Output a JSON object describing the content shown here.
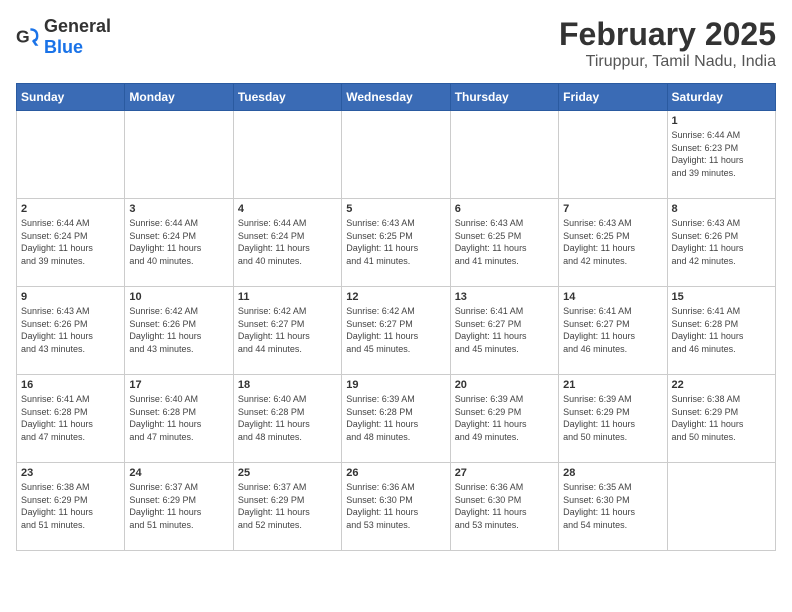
{
  "logo": {
    "general": "General",
    "blue": "Blue"
  },
  "title": "February 2025",
  "subtitle": "Tiruppur, Tamil Nadu, India",
  "days_of_week": [
    "Sunday",
    "Monday",
    "Tuesday",
    "Wednesday",
    "Thursday",
    "Friday",
    "Saturday"
  ],
  "weeks": [
    [
      {
        "day": "",
        "info": ""
      },
      {
        "day": "",
        "info": ""
      },
      {
        "day": "",
        "info": ""
      },
      {
        "day": "",
        "info": ""
      },
      {
        "day": "",
        "info": ""
      },
      {
        "day": "",
        "info": ""
      },
      {
        "day": "1",
        "info": "Sunrise: 6:44 AM\nSunset: 6:23 PM\nDaylight: 11 hours\nand 39 minutes."
      }
    ],
    [
      {
        "day": "2",
        "info": "Sunrise: 6:44 AM\nSunset: 6:24 PM\nDaylight: 11 hours\nand 39 minutes."
      },
      {
        "day": "3",
        "info": "Sunrise: 6:44 AM\nSunset: 6:24 PM\nDaylight: 11 hours\nand 40 minutes."
      },
      {
        "day": "4",
        "info": "Sunrise: 6:44 AM\nSunset: 6:24 PM\nDaylight: 11 hours\nand 40 minutes."
      },
      {
        "day": "5",
        "info": "Sunrise: 6:43 AM\nSunset: 6:25 PM\nDaylight: 11 hours\nand 41 minutes."
      },
      {
        "day": "6",
        "info": "Sunrise: 6:43 AM\nSunset: 6:25 PM\nDaylight: 11 hours\nand 41 minutes."
      },
      {
        "day": "7",
        "info": "Sunrise: 6:43 AM\nSunset: 6:25 PM\nDaylight: 11 hours\nand 42 minutes."
      },
      {
        "day": "8",
        "info": "Sunrise: 6:43 AM\nSunset: 6:26 PM\nDaylight: 11 hours\nand 42 minutes."
      }
    ],
    [
      {
        "day": "9",
        "info": "Sunrise: 6:43 AM\nSunset: 6:26 PM\nDaylight: 11 hours\nand 43 minutes."
      },
      {
        "day": "10",
        "info": "Sunrise: 6:42 AM\nSunset: 6:26 PM\nDaylight: 11 hours\nand 43 minutes."
      },
      {
        "day": "11",
        "info": "Sunrise: 6:42 AM\nSunset: 6:27 PM\nDaylight: 11 hours\nand 44 minutes."
      },
      {
        "day": "12",
        "info": "Sunrise: 6:42 AM\nSunset: 6:27 PM\nDaylight: 11 hours\nand 45 minutes."
      },
      {
        "day": "13",
        "info": "Sunrise: 6:41 AM\nSunset: 6:27 PM\nDaylight: 11 hours\nand 45 minutes."
      },
      {
        "day": "14",
        "info": "Sunrise: 6:41 AM\nSunset: 6:27 PM\nDaylight: 11 hours\nand 46 minutes."
      },
      {
        "day": "15",
        "info": "Sunrise: 6:41 AM\nSunset: 6:28 PM\nDaylight: 11 hours\nand 46 minutes."
      }
    ],
    [
      {
        "day": "16",
        "info": "Sunrise: 6:41 AM\nSunset: 6:28 PM\nDaylight: 11 hours\nand 47 minutes."
      },
      {
        "day": "17",
        "info": "Sunrise: 6:40 AM\nSunset: 6:28 PM\nDaylight: 11 hours\nand 47 minutes."
      },
      {
        "day": "18",
        "info": "Sunrise: 6:40 AM\nSunset: 6:28 PM\nDaylight: 11 hours\nand 48 minutes."
      },
      {
        "day": "19",
        "info": "Sunrise: 6:39 AM\nSunset: 6:28 PM\nDaylight: 11 hours\nand 48 minutes."
      },
      {
        "day": "20",
        "info": "Sunrise: 6:39 AM\nSunset: 6:29 PM\nDaylight: 11 hours\nand 49 minutes."
      },
      {
        "day": "21",
        "info": "Sunrise: 6:39 AM\nSunset: 6:29 PM\nDaylight: 11 hours\nand 50 minutes."
      },
      {
        "day": "22",
        "info": "Sunrise: 6:38 AM\nSunset: 6:29 PM\nDaylight: 11 hours\nand 50 minutes."
      }
    ],
    [
      {
        "day": "23",
        "info": "Sunrise: 6:38 AM\nSunset: 6:29 PM\nDaylight: 11 hours\nand 51 minutes."
      },
      {
        "day": "24",
        "info": "Sunrise: 6:37 AM\nSunset: 6:29 PM\nDaylight: 11 hours\nand 51 minutes."
      },
      {
        "day": "25",
        "info": "Sunrise: 6:37 AM\nSunset: 6:29 PM\nDaylight: 11 hours\nand 52 minutes."
      },
      {
        "day": "26",
        "info": "Sunrise: 6:36 AM\nSunset: 6:30 PM\nDaylight: 11 hours\nand 53 minutes."
      },
      {
        "day": "27",
        "info": "Sunrise: 6:36 AM\nSunset: 6:30 PM\nDaylight: 11 hours\nand 53 minutes."
      },
      {
        "day": "28",
        "info": "Sunrise: 6:35 AM\nSunset: 6:30 PM\nDaylight: 11 hours\nand 54 minutes."
      },
      {
        "day": "",
        "info": ""
      }
    ]
  ]
}
